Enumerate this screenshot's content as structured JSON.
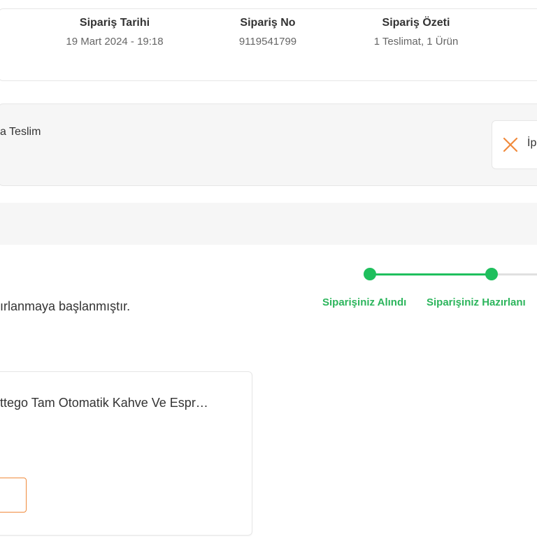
{
  "order_summary": {
    "date_title": "Sipariş Tarihi",
    "date_value": "19 Mart 2024 - 19:18",
    "number_title": "Sipariş No",
    "number_value": "9119541799",
    "summary_title": "Sipariş Özeti",
    "summary_value": "1 Teslimat, 1 Ürün"
  },
  "delivery": {
    "title": "a Teslim",
    "cancel_label": "İp"
  },
  "status": {
    "message": "ırlanmaya başlanmıştır."
  },
  "tracker": {
    "active_color": "#1fbf5d",
    "inactive_color": "#e0e0e0",
    "steps": [
      {
        "label": "Siparişiniz Alındı"
      },
      {
        "label": "Siparişiniz Hazırlanı"
      }
    ]
  },
  "product": {
    "name": "ttego Tam Otomatik Kahve Ve Espr…"
  },
  "colors": {
    "accent_orange": "#f08a3c",
    "success_green": "#2cb55c"
  }
}
